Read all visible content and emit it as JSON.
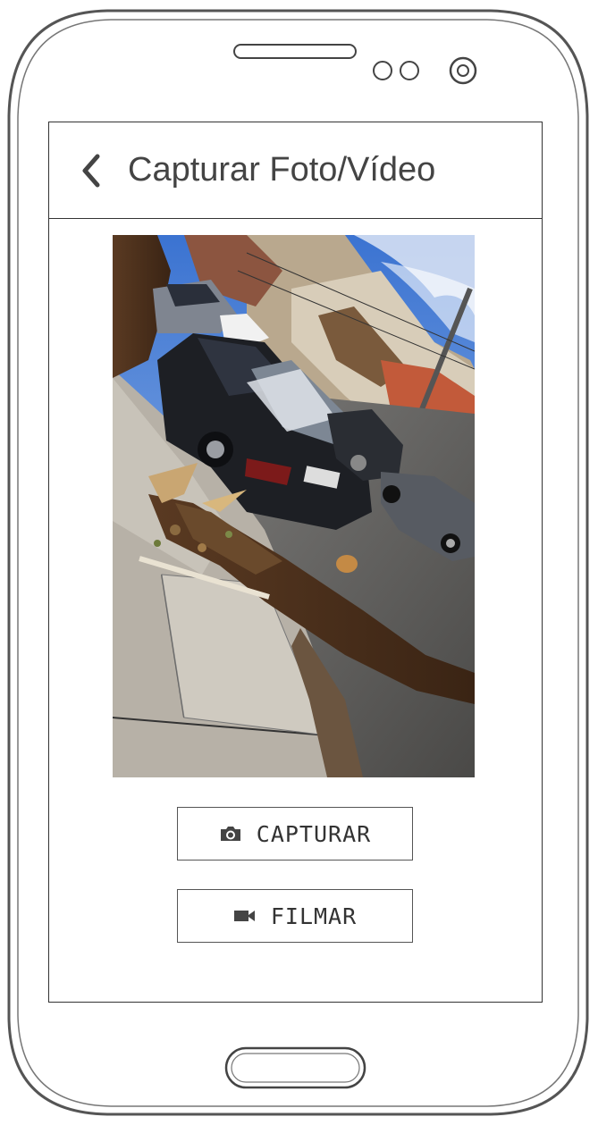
{
  "header": {
    "title": "Capturar Foto/Vídeo"
  },
  "photo": {
    "subject": "fallen tree trunk on broken sidewalk next to parked cars"
  },
  "actions": {
    "capture_label": "CAPTURAR",
    "film_label": "FILMAR"
  },
  "icons": {
    "back": "chevron-left-icon",
    "capture": "camera-icon",
    "film": "video-camera-icon"
  }
}
